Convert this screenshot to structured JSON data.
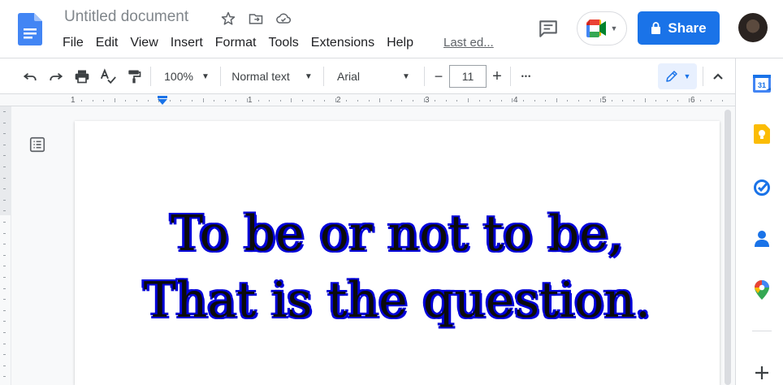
{
  "header": {
    "doc_title": "Untitled document",
    "menu": [
      "File",
      "Edit",
      "View",
      "Insert",
      "Format",
      "Tools",
      "Extensions",
      "Help"
    ],
    "last_edit": "Last ed...",
    "share_label": "Share"
  },
  "toolbar": {
    "zoom": "100%",
    "style": "Normal text",
    "font": "Arial",
    "font_size": "11",
    "minus": "−",
    "plus": "+",
    "more": "•••"
  },
  "ruler": {
    "numbers": [
      "1",
      "1",
      "2",
      "3",
      "4",
      "5",
      "6"
    ]
  },
  "document": {
    "line1": "To be or not to be,",
    "line2": "That is the question."
  },
  "side_panel": {
    "calendar_day": "31"
  },
  "colors": {
    "accent": "#1a73e8",
    "text_outline": "#0000d8"
  }
}
